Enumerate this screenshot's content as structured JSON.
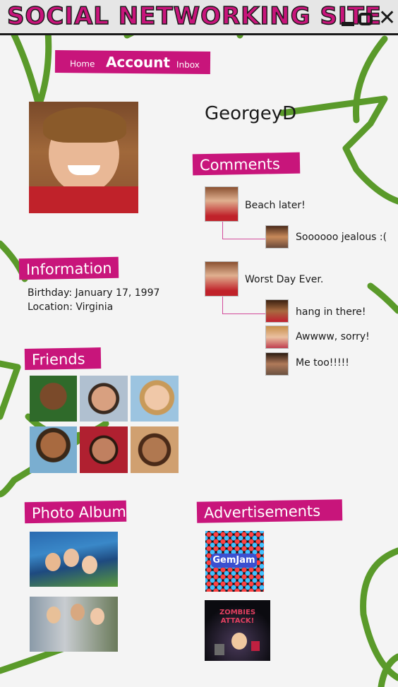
{
  "window": {
    "title": "SOCIAL NETWORKING SITE"
  },
  "nav": {
    "home": "Home",
    "account": "Account",
    "inbox": "Inbox"
  },
  "profile": {
    "username": "GeorgeyD"
  },
  "sections": {
    "comments": "Comments",
    "information": "Information",
    "friends": "Friends",
    "photo_album": "Photo Album",
    "advertisements": "Advertisements"
  },
  "information": {
    "birthday": "Birthday: January 17, 1997",
    "location": "Location: Virginia"
  },
  "comments": [
    {
      "text": "Beach later!",
      "replies": [
        {
          "text": "Soooooo jealous :("
        }
      ]
    },
    {
      "text": "Worst Day Ever.",
      "replies": [
        {
          "text": "hang in there!"
        },
        {
          "text": "Awwww, sorry!"
        },
        {
          "text": "Me too!!!!!"
        }
      ]
    }
  ],
  "ads": {
    "ad1_logo": "GemJam",
    "ad2_title": "ZOMBIES ATTACK!"
  },
  "colors": {
    "accent": "#c8157b",
    "scribble": "#5a9a2a",
    "titlebar": "#e6e6e6"
  }
}
